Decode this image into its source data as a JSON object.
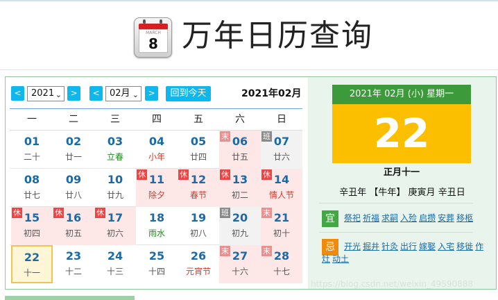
{
  "header": {
    "title": "万年日历查询",
    "icon": {
      "month": "MARCH",
      "day": "8"
    }
  },
  "toolbar": {
    "year_prev": "<",
    "year_value": "2021",
    "year_next": ">",
    "month_prev": "<",
    "month_value": "02月",
    "month_next": ">",
    "today_label": "回到今天",
    "current_label": "2021年02月"
  },
  "weekdays": [
    "一",
    "二",
    "三",
    "四",
    "五",
    "六",
    "日"
  ],
  "days": [
    {
      "n": "01",
      "s": "二十",
      "type": "",
      "tag": ""
    },
    {
      "n": "02",
      "s": "廿一",
      "type": "",
      "tag": ""
    },
    {
      "n": "03",
      "s": "立春",
      "type": "term",
      "tag": ""
    },
    {
      "n": "04",
      "s": "小年",
      "type": "festival",
      "tag": ""
    },
    {
      "n": "05",
      "s": "廿四",
      "type": "",
      "tag": ""
    },
    {
      "n": "06",
      "s": "廿五",
      "type": "",
      "tag": "末",
      "bg": "we"
    },
    {
      "n": "07",
      "s": "廿六",
      "type": "",
      "tag": "班",
      "bg": "ban"
    },
    {
      "n": "08",
      "s": "廿七",
      "type": "",
      "tag": ""
    },
    {
      "n": "09",
      "s": "廿八",
      "type": "",
      "tag": ""
    },
    {
      "n": "10",
      "s": "廿九",
      "type": "",
      "tag": ""
    },
    {
      "n": "11",
      "s": "除夕",
      "type": "festival",
      "tag": "休",
      "bg": "we"
    },
    {
      "n": "12",
      "s": "春节",
      "type": "festival",
      "tag": "休",
      "bg": "we"
    },
    {
      "n": "13",
      "s": "初二",
      "type": "",
      "tag": "休",
      "bg": "we"
    },
    {
      "n": "14",
      "s": "情人节",
      "type": "festival",
      "tag": "休",
      "bg": "we"
    },
    {
      "n": "15",
      "s": "初四",
      "type": "",
      "tag": "休",
      "bg": "we"
    },
    {
      "n": "16",
      "s": "初五",
      "type": "",
      "tag": "休",
      "bg": "we"
    },
    {
      "n": "17",
      "s": "初六",
      "type": "",
      "tag": "休",
      "bg": "we"
    },
    {
      "n": "18",
      "s": "雨水",
      "type": "term",
      "tag": ""
    },
    {
      "n": "19",
      "s": "初八",
      "type": "",
      "tag": ""
    },
    {
      "n": "20",
      "s": "初九",
      "type": "",
      "tag": "班",
      "bg": "ban"
    },
    {
      "n": "21",
      "s": "初十",
      "type": "",
      "tag": "末",
      "bg": "we"
    },
    {
      "n": "22",
      "s": "十一",
      "type": "",
      "tag": "",
      "bg": "today"
    },
    {
      "n": "23",
      "s": "十二",
      "type": "",
      "tag": ""
    },
    {
      "n": "24",
      "s": "十三",
      "type": "",
      "tag": ""
    },
    {
      "n": "25",
      "s": "十四",
      "type": "",
      "tag": ""
    },
    {
      "n": "26",
      "s": "元宵节",
      "type": "festival",
      "tag": ""
    },
    {
      "n": "27",
      "s": "十六",
      "type": "",
      "tag": "末",
      "bg": "we"
    },
    {
      "n": "28",
      "s": "十七",
      "type": "",
      "tag": "末",
      "bg": "we"
    }
  ],
  "detail": {
    "date_bar": "2021年 02月 (小) 星期一",
    "big_day": "22",
    "lunar": "正月十一",
    "ganzhi": "辛丑年 【牛年】 庚寅月 辛丑日",
    "yi_label": "宜",
    "yi": [
      "祭祀",
      "祈福",
      "求嗣",
      "入殓",
      "启攒",
      "安葬",
      "移柩"
    ],
    "ji_label": "忌",
    "ji": [
      "开光",
      "掘井",
      "针灸",
      "出行",
      "嫁娶",
      "入宅",
      "移徙",
      "作灶",
      "动土"
    ]
  },
  "watermark": "https://blog.csdn.net/weixin_49590888",
  "colors": {
    "accent": "#0eb7ec",
    "green": "#3d9a3b",
    "gold": "#fbbf00",
    "holiday": "#e44"
  }
}
